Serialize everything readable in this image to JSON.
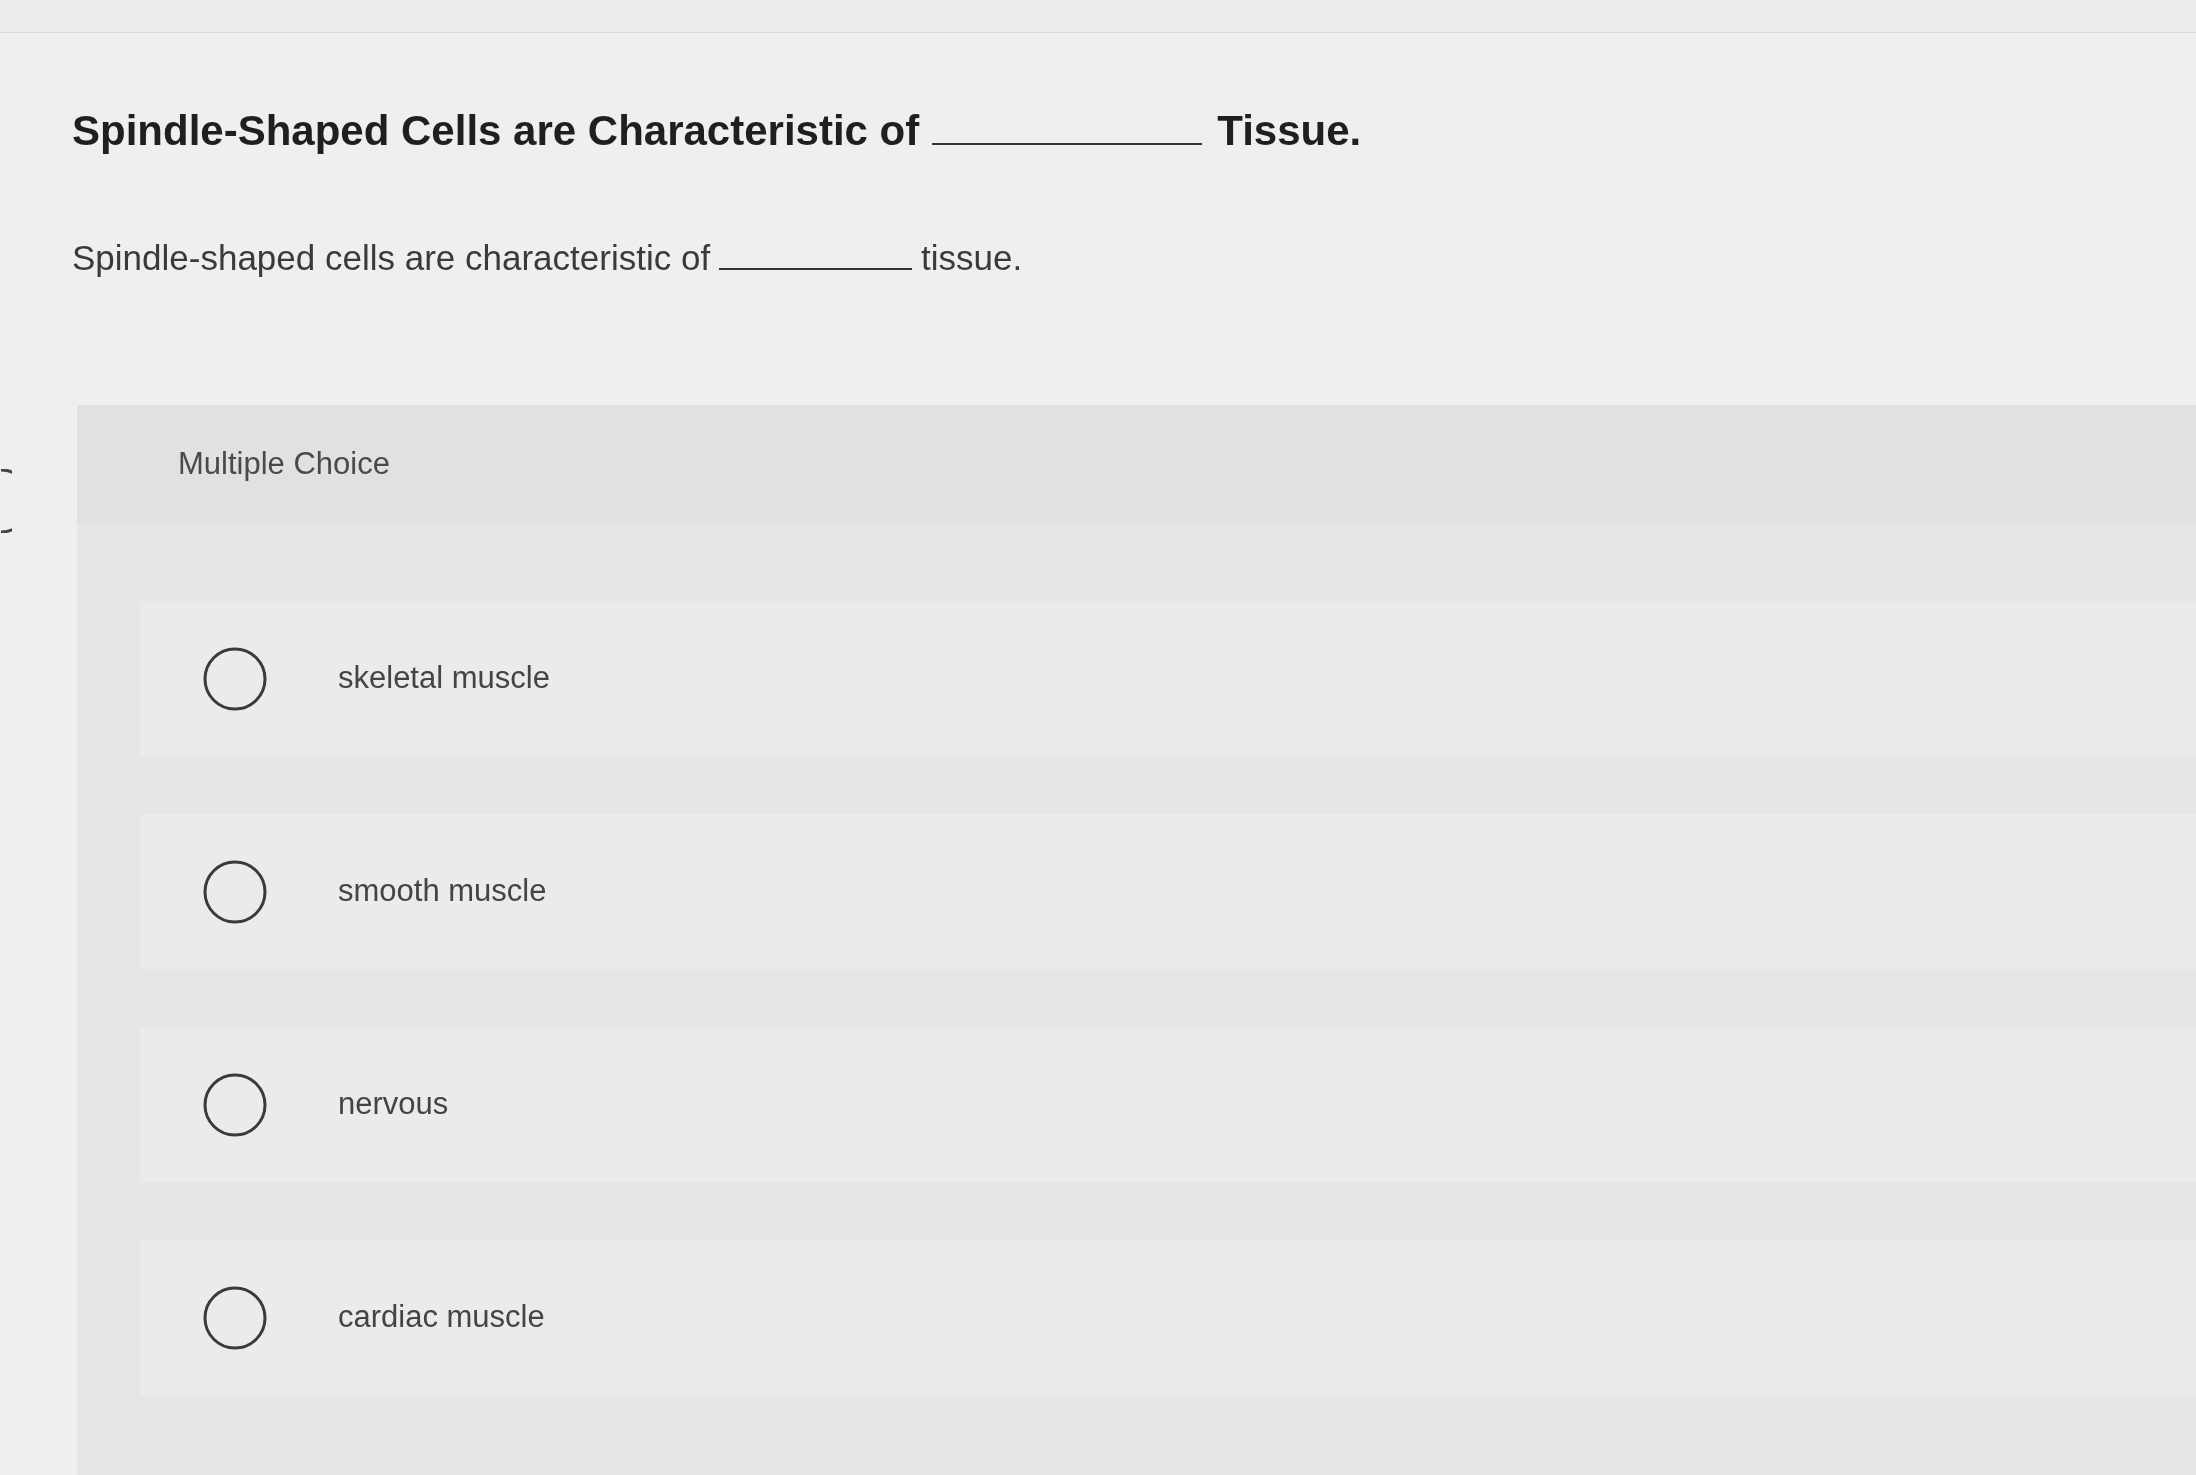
{
  "question": {
    "title": {
      "before": "Spindle-Shaped Cells are Characteristic of",
      "after": "Tissue."
    },
    "prompt": {
      "before": "Spindle-shaped cells are characteristic of",
      "after": "tissue."
    }
  },
  "answer_panel": {
    "heading": "Multiple Choice",
    "options": [
      {
        "label": "skeletal muscle",
        "selected": false
      },
      {
        "label": "smooth muscle",
        "selected": false
      },
      {
        "label": "nervous",
        "selected": false
      },
      {
        "label": "cardiac muscle",
        "selected": false
      }
    ]
  }
}
